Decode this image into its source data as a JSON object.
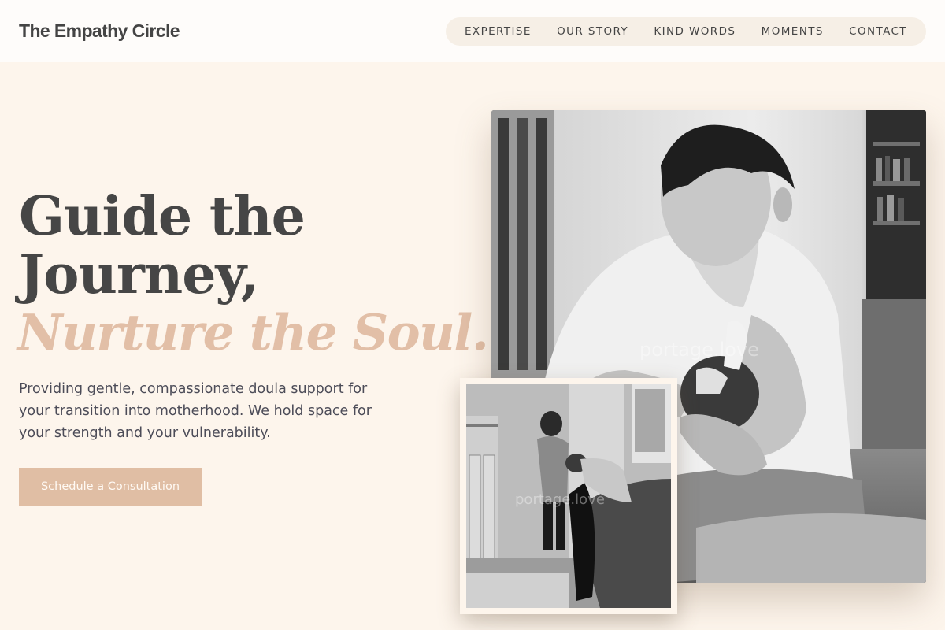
{
  "header": {
    "logo": "The Empathy Circle",
    "nav": [
      "EXPERTISE",
      "OUR STORY",
      "KIND WORDS",
      "MOMENTS",
      "CONTACT"
    ]
  },
  "hero": {
    "title_line1": "Guide the",
    "title_line2": "Journey,",
    "title_accent": "Nurture the Soul.",
    "description": "Providing gentle, compassionate doula support for your transition into motherhood. We hold space for your strength and your vulnerability.",
    "cta_label": "Schedule a Consultation"
  },
  "photos": {
    "watermark": "portage.love"
  },
  "colors": {
    "background": "#fdf5ec",
    "accent": "#e2bfa7",
    "cta": "#e0bea4",
    "text": "#464646"
  }
}
